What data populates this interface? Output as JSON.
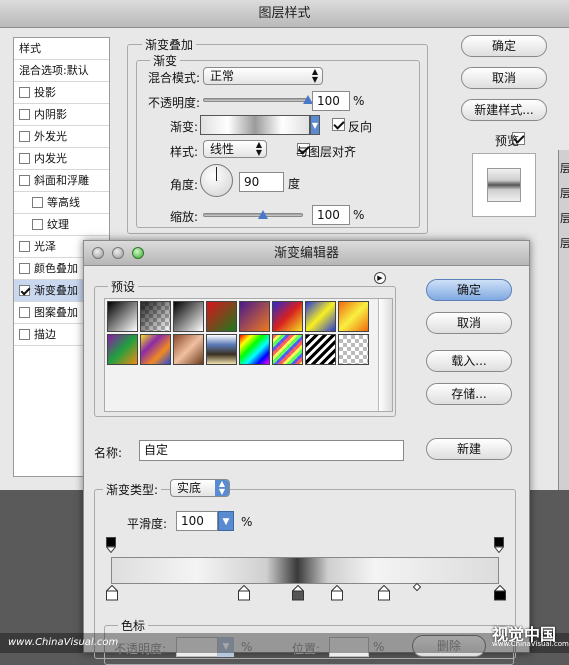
{
  "layer_style": {
    "title": "图层样式",
    "style_list": [
      {
        "label": "样式",
        "checkbox": false,
        "checked": false,
        "indent": false,
        "selected": false
      },
      {
        "label": "混合选项:默认",
        "checkbox": false,
        "checked": false,
        "indent": false,
        "selected": false
      },
      {
        "label": "投影",
        "checkbox": true,
        "checked": false,
        "indent": false,
        "selected": false
      },
      {
        "label": "内阴影",
        "checkbox": true,
        "checked": false,
        "indent": false,
        "selected": false
      },
      {
        "label": "外发光",
        "checkbox": true,
        "checked": false,
        "indent": false,
        "selected": false
      },
      {
        "label": "内发光",
        "checkbox": true,
        "checked": false,
        "indent": false,
        "selected": false
      },
      {
        "label": "斜面和浮雕",
        "checkbox": true,
        "checked": false,
        "indent": false,
        "selected": false
      },
      {
        "label": "等高线",
        "checkbox": true,
        "checked": false,
        "indent": true,
        "selected": false
      },
      {
        "label": "纹理",
        "checkbox": true,
        "checked": false,
        "indent": true,
        "selected": false
      },
      {
        "label": "光泽",
        "checkbox": true,
        "checked": false,
        "indent": false,
        "selected": false
      },
      {
        "label": "颜色叠加",
        "checkbox": true,
        "checked": false,
        "indent": false,
        "selected": false
      },
      {
        "label": "渐变叠加",
        "checkbox": true,
        "checked": true,
        "indent": false,
        "selected": true
      },
      {
        "label": "图案叠加",
        "checkbox": true,
        "checked": false,
        "indent": false,
        "selected": false
      },
      {
        "label": "描边",
        "checkbox": true,
        "checked": false,
        "indent": false,
        "selected": false
      }
    ],
    "section_title": "渐变叠加",
    "subsection_title": "渐变",
    "blend_mode_label": "混合模式:",
    "blend_mode_value": "正常",
    "opacity_label": "不透明度:",
    "opacity_value": "100",
    "percent": "%",
    "gradient_label": "渐变:",
    "reverse_label": "反向",
    "reverse_checked": true,
    "style_label": "样式:",
    "style_value": "线性",
    "align_label": "与图层对齐",
    "align_checked": true,
    "angle_label": "角度:",
    "angle_value": "90",
    "degree_unit": "度",
    "scale_label": "缩放:",
    "scale_value": "100",
    "ok_label": "确定",
    "cancel_label": "取消",
    "new_style_label": "新建样式...",
    "preview_label": "预览",
    "preview_checked": true,
    "opacity_slider_level": 1.0,
    "scale_slider_level": 0.6,
    "right_edge_chars": [
      "层",
      "层",
      "层",
      "层"
    ]
  },
  "gradient_editor": {
    "title": "渐变编辑器",
    "presets_label": "预设",
    "presets_menu_icon": "arrow-circle-icon",
    "presets": [
      {
        "name": "foreground-to-background",
        "css": "linear-gradient(135deg,#000,#fff)"
      },
      {
        "name": "foreground-to-transparent",
        "css": "linear-gradient(135deg,#000 0%,rgba(0,0,0,0) 100%)",
        "checker": true
      },
      {
        "name": "black-white",
        "css": "linear-gradient(135deg,#000,#fff)"
      },
      {
        "name": "red-green",
        "css": "linear-gradient(135deg,#d8141c,#1e7a1e)"
      },
      {
        "name": "violet-orange",
        "css": "linear-gradient(135deg,#4a1a8a,#f07a20)"
      },
      {
        "name": "blue-red-yellow",
        "css": "linear-gradient(135deg,#2a2ad0,#d82020,#f8e020)"
      },
      {
        "name": "blue-yellow-blue",
        "css": "linear-gradient(135deg,#2a3ad8,#f8f020,#2a3ad8)"
      },
      {
        "name": "orange-yellow-orange",
        "css": "linear-gradient(135deg,#f06a10,#f8f040,#f06a10)"
      },
      {
        "name": "violet-green-orange",
        "css": "linear-gradient(135deg,#8a1aa8,#20a040,#f08a10)"
      },
      {
        "name": "yellow-violet-orange-blue",
        "css": "linear-gradient(135deg,#f8e020,#8a2aa8,#f08a20,#2a4ad8)"
      },
      {
        "name": "copper",
        "css": "linear-gradient(135deg,#8a4a2a,#f0c0a0,#6a3a1a)"
      },
      {
        "name": "chrome",
        "css": "linear-gradient(180deg,#fff,#5a7ab8,#3a3020,#f0e0b0)"
      },
      {
        "name": "spectrum",
        "css": "linear-gradient(135deg,#f00,#ff0,#0f0,#0ff,#00f,#f0f)"
      },
      {
        "name": "transparent-rainbow",
        "css": "repeating-linear-gradient(135deg,#f44 0 3px,#ff4 3px 6px,#4f4 6px 9px,#44f 9px 12px)",
        "checker": true
      },
      {
        "name": "transparent-stripes",
        "css": "repeating-linear-gradient(135deg,#000 0 3px,#fff 3px 6px)"
      },
      {
        "name": "transparent",
        "css": "none",
        "checker": true
      }
    ],
    "ok_label": "确定",
    "cancel_label": "取消",
    "load_label": "载入...",
    "save_label": "存储...",
    "name_label": "名称:",
    "name_value": "自定",
    "new_label": "新建",
    "gradient_type_label": "渐变类型:",
    "gradient_type_value": "实底",
    "smoothness_label": "平滑度:",
    "smoothness_value": "100",
    "percent": "%",
    "color_stops_title": "色标",
    "stop_opacity_label": "不透明度:",
    "stop_location_label": "位置:",
    "delete_label": "删除",
    "gradient_bar_css": "linear-gradient(90deg,#dedede 0%,#f4f4f4 22%,#cfcfcf 40%,#3a3a3a 48%,#cfcfcf 56%,#f4f4f4 68%,#dcdcdc 100%)",
    "color_stop_positions": [
      0.0,
      0.34,
      0.48,
      0.58,
      0.7,
      1.0
    ],
    "midpoint_position": 0.79
  },
  "footer": {
    "left_text": "www.ChinaVisual.com",
    "logo_text": "视觉中国",
    "logo_sub": "www.ChinaVisual.com"
  },
  "colors": {
    "accent_blue": "#7fa9e0",
    "selected_row": "#c9d8ef"
  }
}
